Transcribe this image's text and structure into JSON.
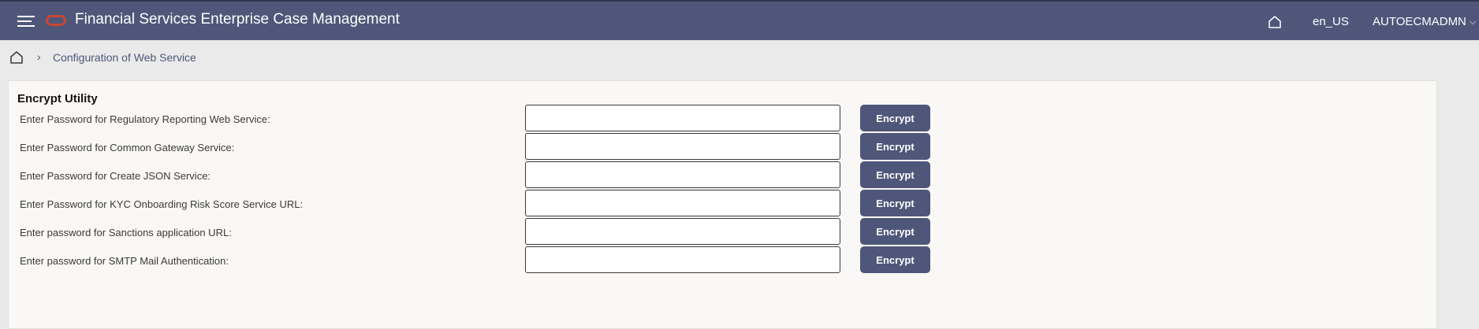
{
  "header": {
    "app_title": "Financial Services Enterprise Case Management",
    "locale": "en_US",
    "user": "AUTOECMADMN",
    "icons": [
      "hamburger-menu-icon",
      "oracle-logo",
      "home-icon",
      "chevron-down-icon"
    ]
  },
  "breadcrumb": {
    "current": "Configuration of Web Service"
  },
  "panel": {
    "title": "Encrypt Utility",
    "rows": [
      {
        "label": "Enter Password for Regulatory Reporting Web Service:",
        "value": "",
        "button": "Encrypt"
      },
      {
        "label": "Enter Password for Common Gateway Service:",
        "value": "",
        "button": "Encrypt"
      },
      {
        "label": "Enter Password for Create JSON Service:",
        "value": "",
        "button": "Encrypt"
      },
      {
        "label": "Enter Password for KYC Onboarding Risk Score Service URL:",
        "value": "",
        "button": "Encrypt"
      },
      {
        "label": "Enter password for Sanctions application URL:",
        "value": "",
        "button": "Encrypt"
      },
      {
        "label": "Enter password for SMTP Mail Authentication:",
        "value": "",
        "button": "Encrypt"
      }
    ]
  },
  "colors": {
    "header_bg": "#4e5779",
    "button_bg": "#4e5779",
    "logo_red": "#c74634",
    "page_bg": "#eaeaea",
    "panel_bg": "#f9f8f6"
  }
}
